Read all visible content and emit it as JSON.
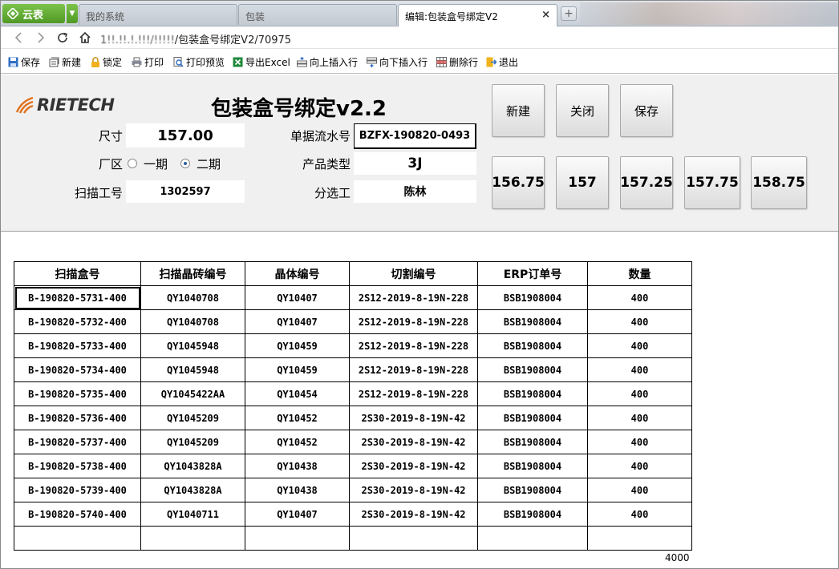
{
  "browser": {
    "brand": "云表",
    "tabs": [
      {
        "label": "我的系统",
        "active": false
      },
      {
        "label": "包装",
        "active": false
      },
      {
        "label": "编辑:包装盒号绑定V2",
        "active": true
      }
    ],
    "close_icon": "×",
    "new_tab_icon": "+",
    "url_prefix": "1!!.!!.!.!!!/!!!!!",
    "url": "/包装盒号绑定V2/70975"
  },
  "toolbar": {
    "items": [
      {
        "label": "保存",
        "icon": "save-icon"
      },
      {
        "label": "新建",
        "icon": "new-icon"
      },
      {
        "label": "锁定",
        "icon": "lock-icon"
      },
      {
        "label": "打印",
        "icon": "print-icon"
      },
      {
        "label": "打印预览",
        "icon": "print-preview-icon"
      },
      {
        "label": "导出Excel",
        "icon": "excel-icon"
      },
      {
        "label": "向上插入行",
        "icon": "insert-row-above-icon"
      },
      {
        "label": "向下插入行",
        "icon": "insert-row-below-icon"
      },
      {
        "label": "删除行",
        "icon": "delete-row-icon"
      },
      {
        "label": "退出",
        "icon": "exit-icon"
      }
    ]
  },
  "form": {
    "logo_text": "RIETECH",
    "title": "包装盒号绑定v2.2",
    "size_label": "尺寸",
    "size_value": "157.00",
    "factory_label": "厂区",
    "factory_options": [
      {
        "label": "一期",
        "checked": false
      },
      {
        "label": "二期",
        "checked": true
      }
    ],
    "scanner_label": "扫描工号",
    "scanner_value": "1302597",
    "serial_label": "单据流水号",
    "serial_value": "BZFX-190820-0493",
    "product_label": "产品类型",
    "product_value": "3J",
    "sorter_label": "分选工",
    "sorter_value": "陈林"
  },
  "buttons": {
    "new": "新建",
    "close": "关闭",
    "save": "保存",
    "sizes": [
      "156.75",
      "157",
      "157.25",
      "157.75",
      "158.75"
    ]
  },
  "grid": {
    "columns": [
      "扫描盒号",
      "扫描晶砖编号",
      "晶体编号",
      "切割编号",
      "ERP订单号",
      "数量"
    ],
    "rows": [
      [
        "B-190820-5731-400",
        "QY1040708",
        "QY10407",
        "2S12-2019-8-19N-228",
        "BSB1908004",
        "400"
      ],
      [
        "B-190820-5732-400",
        "QY1040708",
        "QY10407",
        "2S12-2019-8-19N-228",
        "BSB1908004",
        "400"
      ],
      [
        "B-190820-5733-400",
        "QY1045948",
        "QY10459",
        "2S12-2019-8-19N-228",
        "BSB1908004",
        "400"
      ],
      [
        "B-190820-5734-400",
        "QY1045948",
        "QY10459",
        "2S12-2019-8-19N-228",
        "BSB1908004",
        "400"
      ],
      [
        "B-190820-5735-400",
        "QY1045422AA",
        "QY10454",
        "2S12-2019-8-19N-228",
        "BSB1908004",
        "400"
      ],
      [
        "B-190820-5736-400",
        "QY1045209",
        "QY10452",
        "2S30-2019-8-19N-42",
        "BSB1908004",
        "400"
      ],
      [
        "B-190820-5737-400",
        "QY1045209",
        "QY10452",
        "2S30-2019-8-19N-42",
        "BSB1908004",
        "400"
      ],
      [
        "B-190820-5738-400",
        "QY1043828A",
        "QY10438",
        "2S30-2019-8-19N-42",
        "BSB1908004",
        "400"
      ],
      [
        "B-190820-5739-400",
        "QY1043828A",
        "QY10438",
        "2S30-2019-8-19N-42",
        "BSB1908004",
        "400"
      ],
      [
        "B-190820-5740-400",
        "QY1040711",
        "QY10407",
        "2S30-2019-8-19N-42",
        "BSB1908004",
        "400"
      ]
    ],
    "total": "4000"
  }
}
